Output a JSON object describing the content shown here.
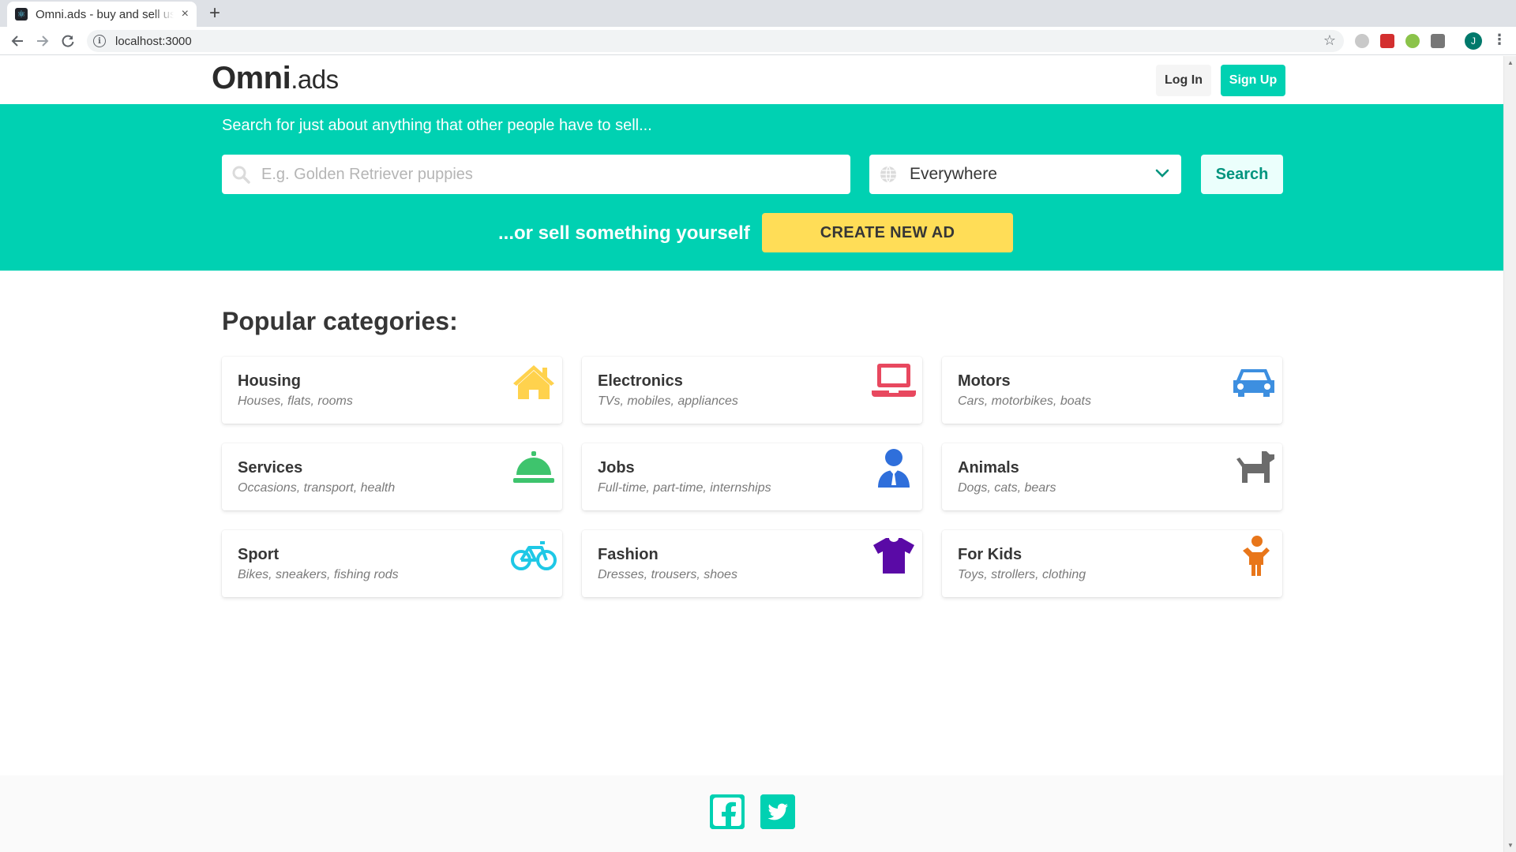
{
  "browser": {
    "tab_title": "Omni.ads - buy and sell used stuff",
    "tab_favicon": "react-icon",
    "new_tab": "+",
    "close_tab": "×",
    "url": "localhost:3000",
    "profile_initial": "J"
  },
  "nav": {
    "logo_brand": "Omni",
    "logo_suffix": ".ads",
    "login_label": "Log In",
    "signup_label": "Sign Up"
  },
  "hero": {
    "subtitle": "Search for just about anything that other people have to sell...",
    "search_placeholder": "E.g. Golden Retriever puppies",
    "location_value": "Everywhere",
    "search_button": "Search",
    "sell_text": "...or sell something yourself",
    "create_button": "CREATE NEW AD",
    "colors": {
      "primary": "#00d1b2",
      "warning": "#ffdd57"
    }
  },
  "categories": {
    "heading": "Popular categories:",
    "items": [
      {
        "title": "Housing",
        "subtitle": "Houses, flats, rooms",
        "icon": "house-icon",
        "color": "#ffd24d"
      },
      {
        "title": "Electronics",
        "subtitle": "TVs, mobiles, appliances",
        "icon": "laptop-icon",
        "color": "#e8485f"
      },
      {
        "title": "Motors",
        "subtitle": "Cars, motorbikes, boats",
        "icon": "car-icon",
        "color": "#3d8fe0"
      },
      {
        "title": "Services",
        "subtitle": "Occasions, transport, health",
        "icon": "service-bell-icon",
        "color": "#3ec46d"
      },
      {
        "title": "Jobs",
        "subtitle": "Full-time, part-time, internships",
        "icon": "businessman-icon",
        "color": "#2f6fdb"
      },
      {
        "title": "Animals",
        "subtitle": "Dogs, cats, bears",
        "icon": "dog-icon",
        "color": "#6b6b6b"
      },
      {
        "title": "Sport",
        "subtitle": "Bikes, sneakers, fishing rods",
        "icon": "bicycle-icon",
        "color": "#1ec8e6"
      },
      {
        "title": "Fashion",
        "subtitle": "Dresses, trousers, shoes",
        "icon": "tshirt-icon",
        "color": "#5a0aa6"
      },
      {
        "title": "For Kids",
        "subtitle": "Toys, strollers, clothing",
        "icon": "child-icon",
        "color": "#e8761a"
      }
    ]
  },
  "footer": {
    "social": [
      {
        "icon": "facebook-icon"
      },
      {
        "icon": "twitter-icon"
      }
    ]
  }
}
